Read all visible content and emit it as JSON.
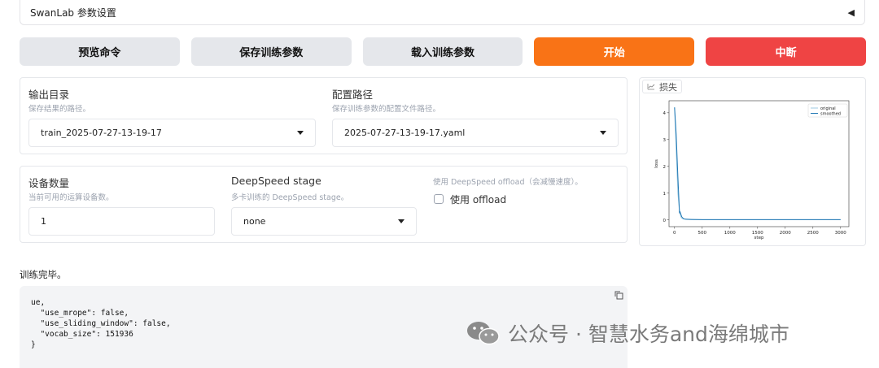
{
  "accordion": {
    "title": "SwanLab 参数设置",
    "toggle": "◀"
  },
  "buttons": {
    "preview": "预览命令",
    "save": "保存训练参数",
    "load": "载入训练参数",
    "start": "开始",
    "abort": "中断"
  },
  "output_dir": {
    "label": "输出目录",
    "sub": "保存结果的路径。",
    "value": "train_2025-07-27-13-19-17"
  },
  "config_path": {
    "label": "配置路径",
    "sub": "保存训练参数的配置文件路径。",
    "value": "2025-07-27-13-19-17.yaml"
  },
  "device_count": {
    "label": "设备数量",
    "sub": "当前可用的运算设备数。",
    "value": "1"
  },
  "ds_stage": {
    "label": "DeepSpeed stage",
    "sub": "多卡训练的 DeepSpeed stage。",
    "value": "none"
  },
  "ds_offload": {
    "sub": "使用 DeepSpeed offload（会减慢速度）。",
    "checkbox_label": "使用 offload",
    "checked": false
  },
  "plot_tab": "损失",
  "chart_data": {
    "type": "line",
    "xlabel": "step",
    "ylabel": "loss",
    "xlim": [
      -100,
      3150
    ],
    "ylim": [
      -0.25,
      4.45
    ],
    "xticks": [
      0,
      500,
      1000,
      1500,
      2000,
      2500,
      3000
    ],
    "yticks": [
      0,
      1,
      2,
      3,
      4
    ],
    "legend_position": "top-right",
    "series": [
      {
        "name": "original",
        "color": "#9ecae1",
        "x": [
          0,
          30,
          60,
          90,
          120,
          150,
          200,
          300,
          500,
          1000,
          2000,
          3000
        ],
        "y": [
          4.2,
          2.6,
          1.0,
          0.3,
          0.08,
          0.04,
          0.02,
          0.01,
          0.01,
          0.01,
          0.01,
          0.01
        ]
      },
      {
        "name": "smoothed",
        "color": "#1f77b4",
        "x": [
          0,
          30,
          60,
          90,
          100,
          130,
          160,
          200,
          300,
          500,
          1000,
          2000,
          3000
        ],
        "y": [
          4.2,
          3.2,
          1.6,
          0.25,
          0.3,
          0.12,
          0.05,
          0.03,
          0.02,
          0.01,
          0.01,
          0.01,
          0.01
        ]
      }
    ]
  },
  "status_text": "训练完毕。",
  "code_output": "ue,\n  \"use_mrope\": false,\n  \"use_sliding_window\": false,\n  \"vocab_size\": 151936\n}",
  "watermark": "公众号 · 智慧水务and海绵城市"
}
